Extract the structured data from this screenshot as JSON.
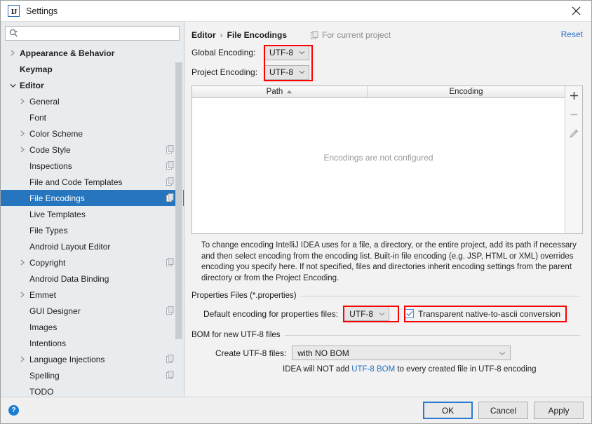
{
  "window": {
    "title": "Settings",
    "logo_glyph": "IJ",
    "close_icon": "close-icon"
  },
  "sidebar": {
    "search": {
      "value": "",
      "placeholder": ""
    },
    "items": [
      {
        "label": "Appearance & Behavior",
        "indent": 0,
        "arrow": "collapsed",
        "bold": true,
        "scope_icon": false,
        "selected": false
      },
      {
        "label": "Keymap",
        "indent": 0,
        "arrow": "none",
        "bold": true,
        "scope_icon": false,
        "selected": false
      },
      {
        "label": "Editor",
        "indent": 0,
        "arrow": "expanded",
        "bold": true,
        "scope_icon": false,
        "selected": false
      },
      {
        "label": "General",
        "indent": 1,
        "arrow": "collapsed",
        "bold": false,
        "scope_icon": false,
        "selected": false
      },
      {
        "label": "Font",
        "indent": 1,
        "arrow": "none",
        "bold": false,
        "scope_icon": false,
        "selected": false
      },
      {
        "label": "Color Scheme",
        "indent": 1,
        "arrow": "collapsed",
        "bold": false,
        "scope_icon": false,
        "selected": false
      },
      {
        "label": "Code Style",
        "indent": 1,
        "arrow": "collapsed",
        "bold": false,
        "scope_icon": true,
        "selected": false
      },
      {
        "label": "Inspections",
        "indent": 1,
        "arrow": "none",
        "bold": false,
        "scope_icon": true,
        "selected": false
      },
      {
        "label": "File and Code Templates",
        "indent": 1,
        "arrow": "none",
        "bold": false,
        "scope_icon": true,
        "selected": false
      },
      {
        "label": "File Encodings",
        "indent": 1,
        "arrow": "none",
        "bold": false,
        "scope_icon": true,
        "selected": true
      },
      {
        "label": "Live Templates",
        "indent": 1,
        "arrow": "none",
        "bold": false,
        "scope_icon": false,
        "selected": false
      },
      {
        "label": "File Types",
        "indent": 1,
        "arrow": "none",
        "bold": false,
        "scope_icon": false,
        "selected": false
      },
      {
        "label": "Android Layout Editor",
        "indent": 1,
        "arrow": "none",
        "bold": false,
        "scope_icon": false,
        "selected": false
      },
      {
        "label": "Copyright",
        "indent": 1,
        "arrow": "collapsed",
        "bold": false,
        "scope_icon": true,
        "selected": false
      },
      {
        "label": "Android Data Binding",
        "indent": 1,
        "arrow": "none",
        "bold": false,
        "scope_icon": false,
        "selected": false
      },
      {
        "label": "Emmet",
        "indent": 1,
        "arrow": "collapsed",
        "bold": false,
        "scope_icon": false,
        "selected": false
      },
      {
        "label": "GUI Designer",
        "indent": 1,
        "arrow": "none",
        "bold": false,
        "scope_icon": true,
        "selected": false
      },
      {
        "label": "Images",
        "indent": 1,
        "arrow": "none",
        "bold": false,
        "scope_icon": false,
        "selected": false
      },
      {
        "label": "Intentions",
        "indent": 1,
        "arrow": "none",
        "bold": false,
        "scope_icon": false,
        "selected": false
      },
      {
        "label": "Language Injections",
        "indent": 1,
        "arrow": "collapsed",
        "bold": false,
        "scope_icon": true,
        "selected": false
      },
      {
        "label": "Spelling",
        "indent": 1,
        "arrow": "none",
        "bold": false,
        "scope_icon": true,
        "selected": false
      },
      {
        "label": "TODO",
        "indent": 1,
        "arrow": "none",
        "bold": false,
        "scope_icon": false,
        "selected": false
      }
    ]
  },
  "content": {
    "breadcrumb": {
      "parent": "Editor",
      "separator": "›",
      "current": "File Encodings"
    },
    "for_current_project": "For current project",
    "reset_label": "Reset",
    "global_encoding": {
      "label": "Global Encoding:",
      "value": "UTF-8"
    },
    "project_encoding": {
      "label": "Project Encoding:",
      "value": "UTF-8"
    },
    "table": {
      "columns": [
        "Path",
        "Encoding"
      ],
      "sort_column": "Path",
      "sort_direction": "ascending",
      "rows": [],
      "empty_message": "Encodings are not configured",
      "tools": [
        "add-icon",
        "remove-icon",
        "edit-icon"
      ]
    },
    "description": "To change encoding IntelliJ IDEA uses for a file, a directory, or the entire project, add its path if necessary and then select encoding from the encoding list. Built-in file encoding (e.g. JSP, HTML or XML) overrides encoding you specify here. If not specified, files and directories inherit encoding settings from the parent directory or from the Project Encoding.",
    "properties_group": {
      "title": "Properties Files (*.properties)",
      "default_encoding_label": "Default encoding for properties files:",
      "default_encoding_value": "UTF-8",
      "transparent_checkbox_label": "Transparent native-to-ascii conversion",
      "transparent_checkbox_checked": true
    },
    "bom_group": {
      "title": "BOM for new UTF-8 files",
      "create_label": "Create UTF-8 files:",
      "create_value": "with NO BOM",
      "hint_before": "IDEA will NOT add ",
      "hint_link": "UTF-8 BOM",
      "hint_after": " to every created file in UTF-8 encoding"
    }
  },
  "footer": {
    "help_glyph": "?",
    "buttons": [
      {
        "label": "OK",
        "default": true
      },
      {
        "label": "Cancel",
        "default": false
      },
      {
        "label": "Apply",
        "default": false
      }
    ]
  },
  "colors": {
    "selection_blue": "#2675bf",
    "link_blue": "#2470c0",
    "highlight_red": "#fe0000",
    "sidebar_bg": "#e8ecef",
    "panel_bg": "#f2f2f2"
  }
}
